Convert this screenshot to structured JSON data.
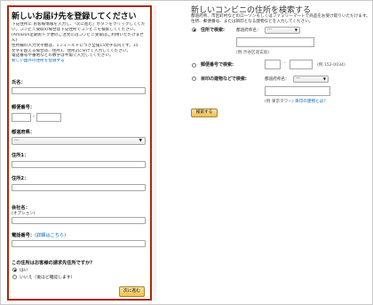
{
  "left": {
    "title": "新しいお届け先を登録してください",
    "instructions": [
      "下記住所に お客様情報を入力し、「次に進む」ボタンをクリックしてくださ",
      "い。コンビニ受取の場合は下記住所でコンビニを検索してください。",
      "(Amazon定期おトク便のご注文にはコンビニ受取はご利用いただけませ",
      "ん)",
      "住所欄の入力文字数は、1フィールドにつき全角15文字以内です。15",
      "文字を超える場合は、住所1、住所2に分けて入力してください。",
      "電話番号や番地などの数字は半角で入力してください。"
    ],
    "overseas_link": "新しい国外の住所を登録する",
    "name_label": "氏名：",
    "zip_label": "郵便番号：",
    "zip_dash": "-",
    "pref_label": "都道府県：",
    "pref_value": "---",
    "addr1_label": "住所1：",
    "addr2_label": "住所2：",
    "company_label": "会社名：",
    "company_optional": "(オプション)",
    "phone_label": "電話番号：",
    "phone_help": "(詳細はこちら)",
    "billing_question": "この住所はお客様の請求先住所ですか？",
    "billing_yes": "はい",
    "billing_no": "いいえ（後ほど確認します）",
    "next_button": "次に進む",
    "arrow": "▼"
  },
  "right": {
    "title": "新しいコンビニの住所を検索する",
    "desc": [
      "都道府県、市区町村などのローソンもしくはファミリーマートで商品をお受け取りいただけます。",
      "住所、郵便番号、または目印となる建物などを入力してください。"
    ],
    "opt1_label": "住所で検索:",
    "opt1_pref_label": "都道府県名：",
    "pref_value": "---",
    "opt1_example": "(例  渋谷区道玄坂)",
    "opt2_label": "郵便番号で検索:",
    "zip_dash": "-",
    "opt2_example": "(例  152-0034)",
    "opt3_label": "目印の建物などで検索:",
    "opt3_pref_label": "都道府県名：",
    "opt3_example": "(例  東京タワー)",
    "opt3_help": "目印の建物とは？",
    "search_button": "検索する",
    "arrow": "▼"
  }
}
